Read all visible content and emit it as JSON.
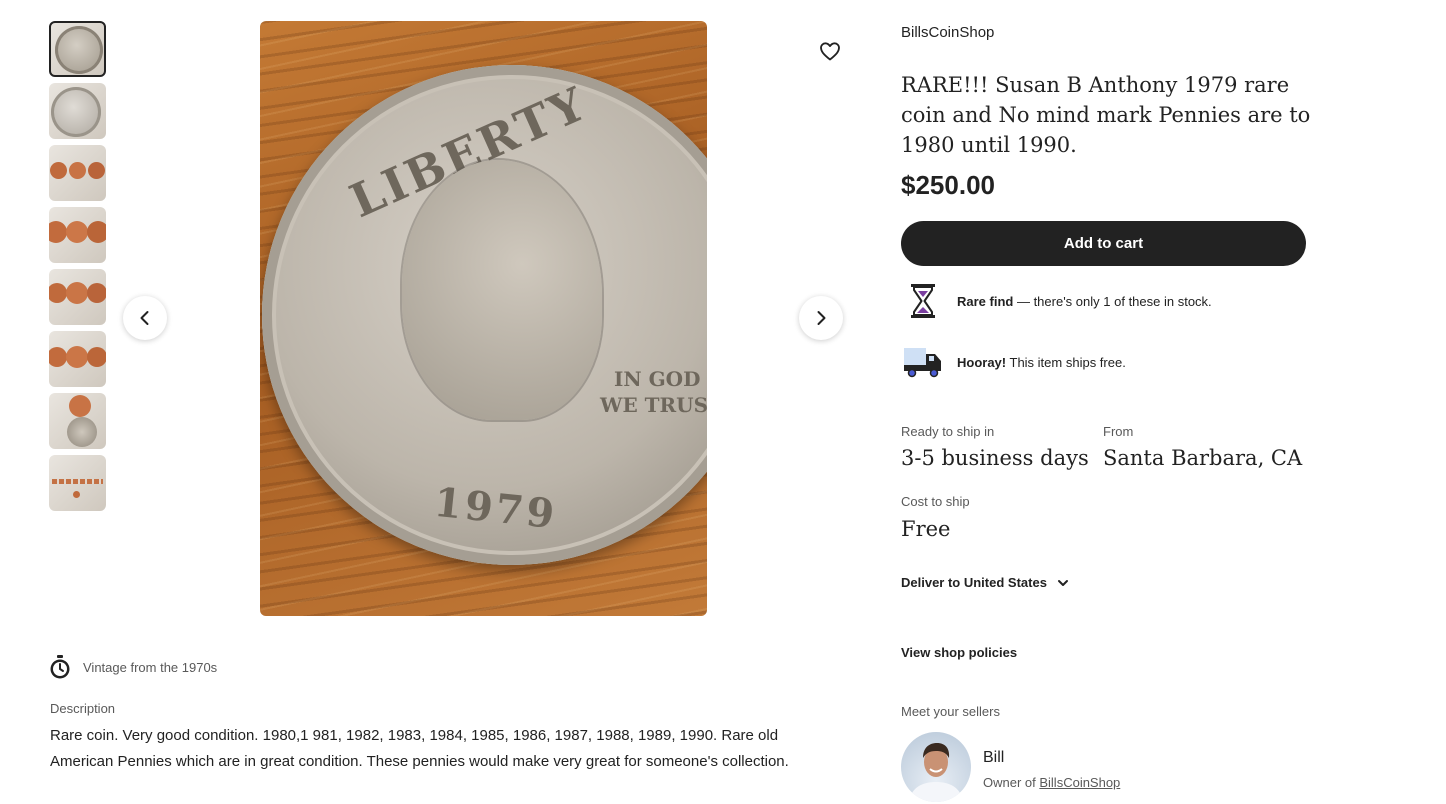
{
  "gallery": {
    "thumbnail_count": 8,
    "selected_index": 0,
    "main_image": {
      "coin_legend": "LIBERTY",
      "coin_motto_line1": "IN GOD",
      "coin_motto_line2": "WE TRUST",
      "coin_year": "1979"
    }
  },
  "listing": {
    "shop_name": "BillsCoinShop",
    "title": "RARE!!! Susan B Anthony 1979 rare coin and No mind mark Pennies are to 1980 until 1990.",
    "price": "$250.00",
    "add_to_cart_label": "Add to cart"
  },
  "badges": {
    "rare_find_bold": "Rare find",
    "rare_find_text_before": " — there's only ",
    "rare_find_count": "1",
    "rare_find_text_after": " of these in stock.",
    "ships_free_bold": "Hooray!",
    "ships_free_text": " This item ships free."
  },
  "shipping": {
    "ready_label": "Ready to ship in",
    "ready_value": "3-5 business days",
    "from_label": "From",
    "from_value": "Santa Barbara, CA",
    "cost_label": "Cost to ship",
    "cost_value": "Free",
    "deliver_label": "Deliver to United States"
  },
  "policies_link": "View shop policies",
  "seller": {
    "section_label": "Meet your sellers",
    "name": "Bill",
    "owner_prefix": "Owner of ",
    "owner_shop": "BillsCoinShop"
  },
  "details": {
    "vintage_text": "Vintage from the 1970s",
    "description_label": "Description",
    "description_text": "Rare coin. Very good condition. 1980,1 981, 1982, 1983, 1984, 1985, 1986, 1987, 1988, 1989, 1990. Rare old American Pennies which are in great condition. These pennies would make very great for someone's collection."
  },
  "icons": {
    "favorite": "heart-icon",
    "prev": "chevron-left-icon",
    "next": "chevron-right-icon",
    "rare": "hourglass-icon",
    "shipping": "truck-icon",
    "vintage": "stopwatch-icon",
    "deliver": "chevron-down-icon"
  },
  "colors": {
    "primary_button": "#222222",
    "hourglass_accent": "#7b3fa0",
    "truck_wheel": "#4a5bd4"
  }
}
